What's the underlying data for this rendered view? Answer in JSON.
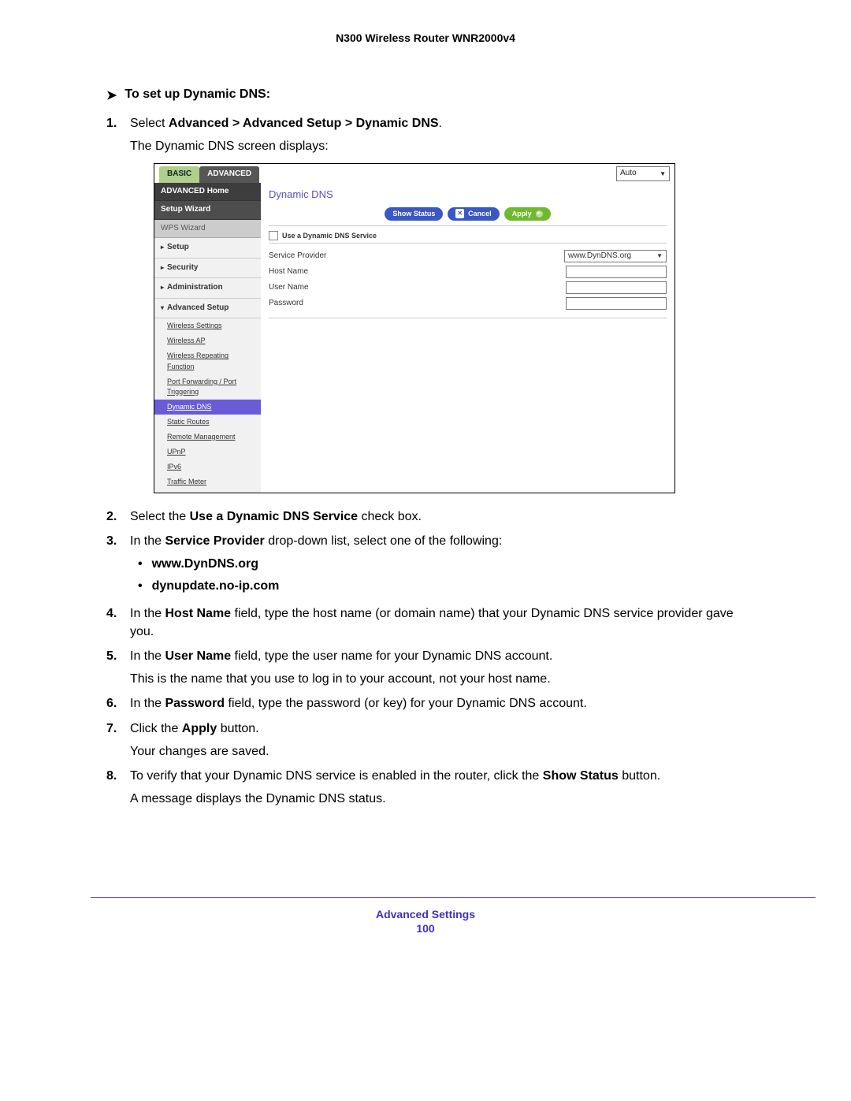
{
  "doc_title": "N300 Wireless Router WNR2000v4",
  "task_heading": "To set up Dynamic DNS:",
  "steps": {
    "s1": {
      "num": "1.",
      "prefix": "Select ",
      "path": "Advanced > Advanced Setup > Dynamic DNS",
      "suffix": ".",
      "followup": "The Dynamic DNS screen displays:"
    },
    "s2": {
      "num": "2.",
      "prefix": "Select the ",
      "bold": "Use a Dynamic DNS Service",
      "suffix": " check box."
    },
    "s3": {
      "num": "3.",
      "prefix": "In the ",
      "bold": "Service Provider",
      "suffix": " drop-down list, select one of the following:",
      "bullets": [
        "www.DynDNS.org",
        "dynupdate.no-ip.com"
      ]
    },
    "s4": {
      "num": "4.",
      "prefix": "In the ",
      "bold": "Host Name",
      "suffix": " field, type the host name (or domain name) that your Dynamic DNS service provider gave you."
    },
    "s5": {
      "num": "5.",
      "prefix": "In the ",
      "bold": "User Name",
      "suffix": " field, type the user name for your Dynamic DNS account.",
      "followup": "This is the name that you use to log in to your account, not your host name."
    },
    "s6": {
      "num": "6.",
      "prefix": "In the ",
      "bold": "Password",
      "suffix": " field, type the password (or key) for your Dynamic DNS account."
    },
    "s7": {
      "num": "7.",
      "prefix": "Click the ",
      "bold": "Apply",
      "suffix": " button.",
      "followup": "Your changes are saved."
    },
    "s8": {
      "num": "8.",
      "prefix": "To verify that your Dynamic DNS service is enabled in the router, click the ",
      "bold": "Show Status",
      "suffix": " button.",
      "followup": "A message displays the Dynamic DNS status."
    }
  },
  "shot": {
    "tab_basic": "BASIC",
    "tab_advanced": "ADVANCED",
    "auto": "Auto",
    "sidebar": {
      "home": "ADVANCED Home",
      "setup_wizard": "Setup Wizard",
      "wps_wizard": "WPS Wizard",
      "setup": "Setup",
      "security": "Security",
      "admin": "Administration",
      "adv_setup": "Advanced Setup",
      "subs": [
        "Wireless Settings",
        "Wireless AP",
        "Wireless Repeating Function",
        "Port Forwarding / Port Triggering",
        "Dynamic DNS",
        "Static Routes",
        "Remote Management",
        "UPnP",
        "IPv6",
        "Traffic Meter"
      ]
    },
    "main": {
      "title": "Dynamic DNS",
      "btn_show": "Show Status",
      "btn_cancel": "Cancel",
      "btn_apply": "Apply",
      "chk_label": "Use a Dynamic DNS Service",
      "lbl_provider": "Service Provider",
      "sel_provider": "www.DynDNS.org",
      "lbl_host": "Host Name",
      "lbl_user": "User Name",
      "lbl_pass": "Password"
    }
  },
  "footer": {
    "section": "Advanced Settings",
    "page": "100"
  }
}
